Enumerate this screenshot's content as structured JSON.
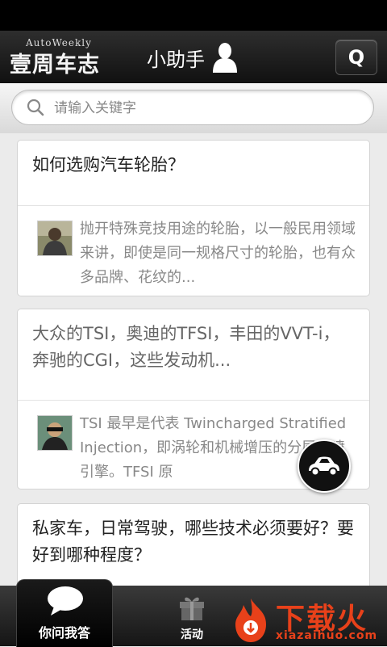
{
  "header": {
    "logo_en": "AutoWeekly",
    "logo_cn": "壹周车志",
    "assistant_label": "小助手",
    "search_button_label": "Q"
  },
  "search": {
    "placeholder": "请输入关键字",
    "value": ""
  },
  "feed": [
    {
      "question": "如何选购汽车轮胎？",
      "answer": "抛开特殊竞技用途的轮胎，以一般民用领域来讲，即使是同一规格尺寸的轮胎，也有众多品牌、花纹的..."
    },
    {
      "question": "大众的TSI，奥迪的TFSI，丰田的VVT-i，奔驰的CGI，这些发动机...",
      "answer": "TSI 最早是代表 Twincharged Stratified Injection，即涡轮和机械增压的分层直喷引擎。TFSI 原"
    },
    {
      "question": "私家车，日常驾驶，哪些技术必须要好？要好到哪种程度？",
      "answer": ""
    }
  ],
  "tabs": [
    {
      "label": "你问我答",
      "icon": "speech-bubble-icon",
      "active": true
    },
    {
      "label": "活动",
      "icon": "gift-icon",
      "active": false
    }
  ],
  "watermark": {
    "cn": "下载火",
    "en": "xiazaihuo.com"
  },
  "colors": {
    "header_bg": "#1a1a1a",
    "accent": "#e8411a",
    "card_bg": "#ffffff",
    "page_bg": "#ebebeb"
  }
}
